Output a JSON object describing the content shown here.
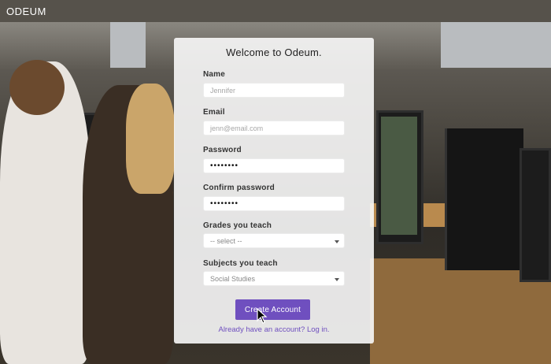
{
  "header": {
    "logo_text": "ODEUM",
    "logo_icon": "odeum-logo-icon"
  },
  "form": {
    "title": "Welcome to Odeum.",
    "name_label": "Name",
    "name_placeholder": "Jennifer",
    "email_label": "Email",
    "email_placeholder": "jenn@email.com",
    "password_label": "Password",
    "password_value": "••••••••",
    "confirm_label": "Confirm password",
    "confirm_value": "••••••••",
    "grades_label": "Grades you teach",
    "grades_value": "-- select --",
    "subjects_label": "Subjects you teach",
    "subjects_value": "Social Studies",
    "submit_label": "Create Account",
    "login_text": "Already have an account? Log in."
  },
  "colors": {
    "accent": "#6f4fbf",
    "topbar": "#56524b"
  }
}
